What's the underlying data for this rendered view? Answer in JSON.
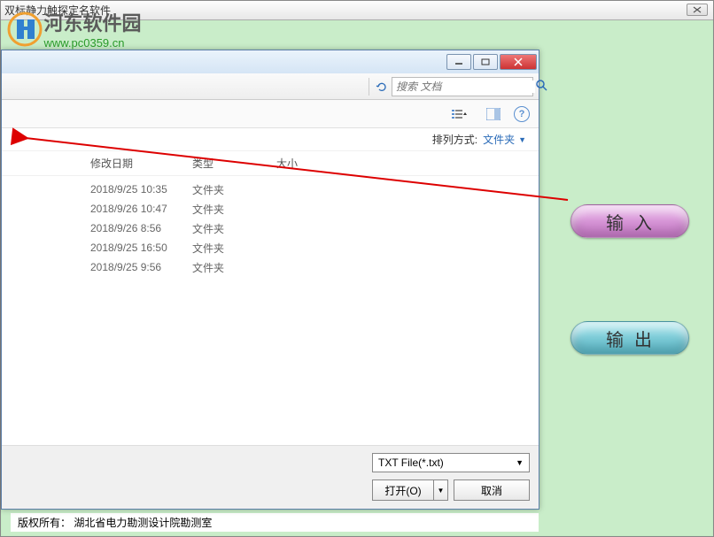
{
  "outer": {
    "title": "双标静力触探定名软件"
  },
  "watermark": {
    "main": "河东软件园",
    "sub": "www.pc0359.cn"
  },
  "dialog": {
    "search_placeholder": "搜索 文档",
    "sort_label": "排列方式:",
    "sort_value": "文件夹",
    "headers": {
      "date": "修改日期",
      "type": "类型",
      "size": "大小"
    },
    "rows": [
      {
        "date": "2018/9/25 10:35",
        "type": "文件夹"
      },
      {
        "date": "2018/9/26 10:47",
        "type": "文件夹"
      },
      {
        "date": "2018/9/26 8:56",
        "type": "文件夹"
      },
      {
        "date": "2018/9/25 16:50",
        "type": "文件夹"
      },
      {
        "date": "2018/9/25 9:56",
        "type": "文件夹"
      }
    ],
    "filter": "TXT File(*.txt)",
    "open_label": "打开(O)",
    "cancel_label": "取消"
  },
  "buttons": {
    "input": "输入",
    "output": "输出"
  },
  "copyright": "版权所有：  湖北省电力勘测设计院勘测室"
}
